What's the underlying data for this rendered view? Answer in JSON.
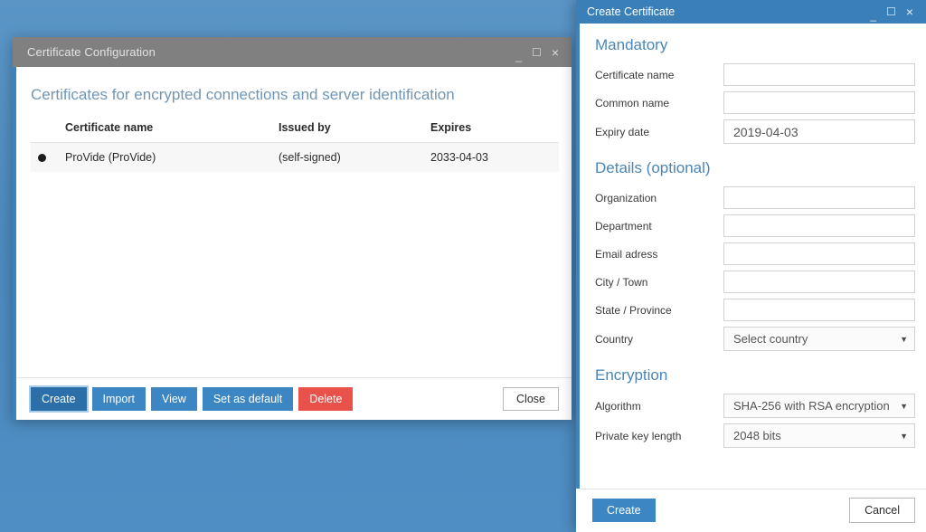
{
  "desktop": {
    "background_color": "#4c89bd"
  },
  "cert_config_window": {
    "title": "Certificate Configuration",
    "window_controls": {
      "minimize": "_",
      "maximize": "☐",
      "close": "×"
    },
    "heading": "Certificates for encrypted connections and server identification",
    "table": {
      "columns": [
        "",
        "Certificate name",
        "Issued by",
        "Expires"
      ],
      "rows": [
        {
          "icon": "default-certificate-dot-icon",
          "certificate_name": "ProVide (ProVide)",
          "issued_by": "(self-signed)",
          "expires": "2033-04-03"
        }
      ]
    },
    "buttons": {
      "create": "Create",
      "import": "Import",
      "view": "View",
      "set_as_default": "Set as default",
      "delete": "Delete",
      "close": "Close"
    },
    "colors": {
      "titlebar": "#808080",
      "accent": "#3c82bf",
      "primary_button": "#3c86c4",
      "active_button": "#2a6fa8",
      "danger_button": "#e8524a",
      "heading_text": "#7196b5"
    }
  },
  "create_cert_window": {
    "title": "Create Certificate",
    "window_controls": {
      "minimize": "_",
      "maximize": "☐",
      "close": "×"
    },
    "sections": {
      "mandatory": {
        "title": "Mandatory",
        "fields": [
          {
            "label": "Certificate name",
            "value": "",
            "placeholder": "",
            "type": "text"
          },
          {
            "label": "Common name",
            "value": "",
            "placeholder": "",
            "type": "text"
          },
          {
            "label": "Expiry date",
            "value": "2019-04-03",
            "placeholder": "",
            "type": "date"
          }
        ]
      },
      "details": {
        "title": "Details (optional)",
        "fields": [
          {
            "label": "Organization",
            "value": "",
            "placeholder": "",
            "type": "text"
          },
          {
            "label": "Department",
            "value": "",
            "placeholder": "",
            "type": "text"
          },
          {
            "label": "Email adress",
            "value": "",
            "placeholder": "",
            "type": "text"
          },
          {
            "label": "City / Town",
            "value": "",
            "placeholder": "",
            "type": "text"
          },
          {
            "label": "State / Province",
            "value": "",
            "placeholder": "",
            "type": "text"
          },
          {
            "label": "Country",
            "value": "Select country",
            "type": "select"
          }
        ]
      },
      "encryption": {
        "title": "Encryption",
        "fields": [
          {
            "label": "Algorithm",
            "value": "SHA-256 with RSA encryption",
            "type": "select"
          },
          {
            "label": "Private key length",
            "value": "2048 bits",
            "type": "select"
          }
        ]
      }
    },
    "buttons": {
      "create": "Create",
      "cancel": "Cancel"
    },
    "colors": {
      "titlebar": "#3a7fb8",
      "accent": "#3c82bf",
      "section_heading": "#4a86b8"
    }
  }
}
